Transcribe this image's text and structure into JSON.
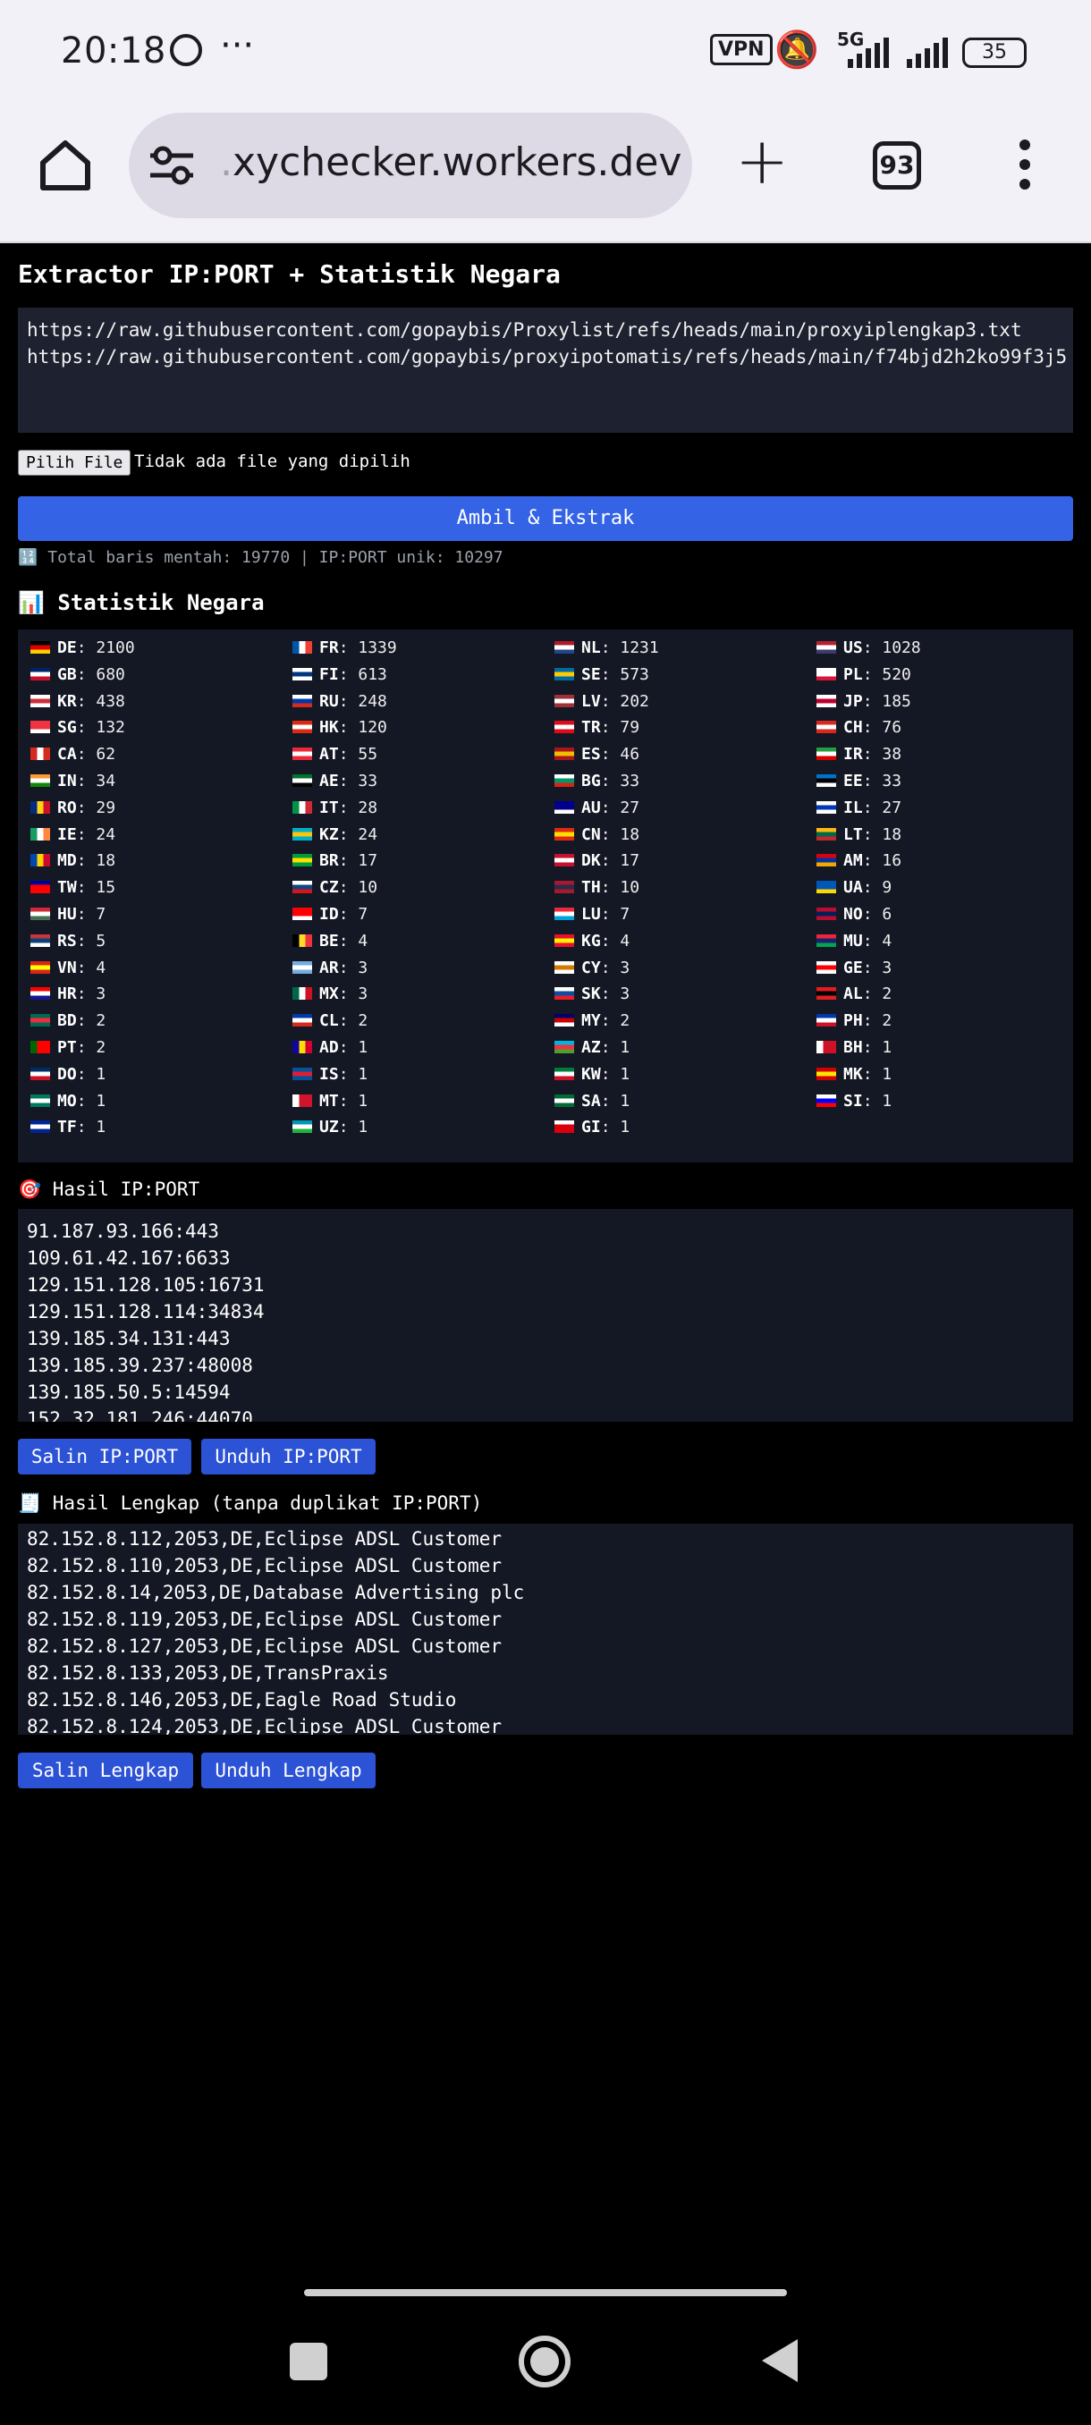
{
  "status": {
    "time": "20:18",
    "vpn": "VPN",
    "network": "5G",
    "battery": "35"
  },
  "browser": {
    "url_prefix": ".",
    "url": "xychecker.workers.dev",
    "tab_count": "93"
  },
  "page": {
    "title": "Extractor IP:PORT + Statistik Negara",
    "urls_text": "https://raw.githubusercontent.com/gopaybis/Proxylist/refs/heads/main/proxyiplengkap3.txt\nhttps://raw.githubusercontent.com/gopaybis/proxyipotomatis/refs/heads/main/f74bjd2h2ko99f3j5",
    "file_button": "Pilih File",
    "file_status": "Tidak ada file yang dipilih",
    "fetch_button": "Ambil & Ekstrak",
    "totals": "🔢 Total baris mentah: 19770 | IP:PORT unik: 10297",
    "stats_heading": "📊 Statistik Negara",
    "result_heading": "🎯 Hasil IP:PORT",
    "result_text": "91.187.93.166:443\n109.61.42.167:6633\n129.151.128.105:16731\n129.151.128.114:34834\n139.185.34.131:443\n139.185.39.237:48008\n139.185.50.5:14594\n152.32.181.246:44070",
    "copy_ip_button": "Salin IP:PORT",
    "download_ip_button": "Unduh IP:PORT",
    "full_heading": "🧾 Hasil Lengkap (tanpa duplikat IP:PORT)",
    "full_text": "82.152.8.112,2053,DE,Eclipse ADSL Customer\n82.152.8.110,2053,DE,Eclipse ADSL Customer\n82.152.8.14,2053,DE,Database Advertising plc\n82.152.8.119,2053,DE,Eclipse ADSL Customer\n82.152.8.127,2053,DE,Eclipse ADSL Customer\n82.152.8.133,2053,DE,TransPraxis\n82.152.8.146,2053,DE,Eagle Road Studio\n82.152.8.124,2053,DE,Eclipse ADSL Customer",
    "copy_full_button": "Salin Lengkap",
    "download_full_button": "Unduh Lengkap"
  },
  "stats": [
    {
      "code": "DE",
      "count": "2100",
      "colors": [
        "#000000",
        "#dd0000",
        "#ffce00"
      ]
    },
    {
      "code": "FR",
      "count": "1339",
      "colors": [
        "#0055a4",
        "#ffffff",
        "#ef4135"
      ],
      "v": true
    },
    {
      "code": "NL",
      "count": "1231",
      "colors": [
        "#ae1c28",
        "#ffffff",
        "#21468b"
      ]
    },
    {
      "code": "US",
      "count": "1028",
      "colors": [
        "#b22234",
        "#ffffff",
        "#3c3b6e"
      ]
    },
    {
      "code": "GB",
      "count": "680",
      "colors": [
        "#012169",
        "#ffffff",
        "#c8102e"
      ]
    },
    {
      "code": "FI",
      "count": "613",
      "colors": [
        "#ffffff",
        "#003580",
        "#ffffff"
      ]
    },
    {
      "code": "SE",
      "count": "573",
      "colors": [
        "#006aa7",
        "#fecc00",
        "#006aa7"
      ]
    },
    {
      "code": "PL",
      "count": "520",
      "colors": [
        "#ffffff",
        "#ffffff",
        "#dc143c"
      ]
    },
    {
      "code": "KR",
      "count": "438",
      "colors": [
        "#ffffff",
        "#cd2e3a",
        "#ffffff"
      ]
    },
    {
      "code": "RU",
      "count": "248",
      "colors": [
        "#ffffff",
        "#0039a6",
        "#d52b1e"
      ]
    },
    {
      "code": "LV",
      "count": "202",
      "colors": [
        "#9e3039",
        "#ffffff",
        "#9e3039"
      ]
    },
    {
      "code": "JP",
      "count": "185",
      "colors": [
        "#ffffff",
        "#bc002d",
        "#ffffff"
      ]
    },
    {
      "code": "SG",
      "count": "132",
      "colors": [
        "#ef3340",
        "#ef3340",
        "#ffffff"
      ]
    },
    {
      "code": "HK",
      "count": "120",
      "colors": [
        "#de2910",
        "#ffffff",
        "#de2910"
      ]
    },
    {
      "code": "TR",
      "count": "79",
      "colors": [
        "#e30a17",
        "#ffffff",
        "#e30a17"
      ]
    },
    {
      "code": "CH",
      "count": "76",
      "colors": [
        "#da291c",
        "#ffffff",
        "#da291c"
      ]
    },
    {
      "code": "CA",
      "count": "62",
      "colors": [
        "#d52b1e",
        "#ffffff",
        "#d52b1e"
      ],
      "v": true
    },
    {
      "code": "AT",
      "count": "55",
      "colors": [
        "#ed2939",
        "#ffffff",
        "#ed2939"
      ]
    },
    {
      "code": "ES",
      "count": "46",
      "colors": [
        "#aa151b",
        "#f1bf00",
        "#aa151b"
      ]
    },
    {
      "code": "IR",
      "count": "38",
      "colors": [
        "#239f40",
        "#ffffff",
        "#da0000"
      ]
    },
    {
      "code": "IN",
      "count": "34",
      "colors": [
        "#ff9933",
        "#ffffff",
        "#138808"
      ]
    },
    {
      "code": "AE",
      "count": "33",
      "colors": [
        "#00732f",
        "#ffffff",
        "#000000"
      ]
    },
    {
      "code": "BG",
      "count": "33",
      "colors": [
        "#ffffff",
        "#00966e",
        "#d62612"
      ]
    },
    {
      "code": "EE",
      "count": "33",
      "colors": [
        "#0072ce",
        "#000000",
        "#ffffff"
      ]
    },
    {
      "code": "RO",
      "count": "29",
      "colors": [
        "#002b7f",
        "#fcd116",
        "#ce1126"
      ],
      "v": true
    },
    {
      "code": "IT",
      "count": "28",
      "colors": [
        "#009246",
        "#ffffff",
        "#ce2b37"
      ],
      "v": true
    },
    {
      "code": "AU",
      "count": "27",
      "colors": [
        "#00008b",
        "#00008b",
        "#ffffff"
      ]
    },
    {
      "code": "IL",
      "count": "27",
      "colors": [
        "#ffffff",
        "#0038b8",
        "#ffffff"
      ]
    },
    {
      "code": "IE",
      "count": "24",
      "colors": [
        "#169b62",
        "#ffffff",
        "#ff883e"
      ],
      "v": true
    },
    {
      "code": "KZ",
      "count": "24",
      "colors": [
        "#00afca",
        "#fec50c",
        "#00afca"
      ]
    },
    {
      "code": "CN",
      "count": "18",
      "colors": [
        "#de2910",
        "#ffde00",
        "#de2910"
      ]
    },
    {
      "code": "LT",
      "count": "18",
      "colors": [
        "#fdb913",
        "#006a44",
        "#c1272d"
      ]
    },
    {
      "code": "MD",
      "count": "18",
      "colors": [
        "#0046ae",
        "#ffd200",
        "#cc092f"
      ],
      "v": true
    },
    {
      "code": "BR",
      "count": "17",
      "colors": [
        "#009c3b",
        "#ffdf00",
        "#009c3b"
      ]
    },
    {
      "code": "DK",
      "count": "17",
      "colors": [
        "#c8102e",
        "#ffffff",
        "#c8102e"
      ]
    },
    {
      "code": "AM",
      "count": "16",
      "colors": [
        "#d90012",
        "#0033a0",
        "#f2a800"
      ]
    },
    {
      "code": "TW",
      "count": "15",
      "colors": [
        "#000095",
        "#fe0000",
        "#fe0000"
      ]
    },
    {
      "code": "CZ",
      "count": "10",
      "colors": [
        "#ffffff",
        "#11457e",
        "#d7141a"
      ]
    },
    {
      "code": "TH",
      "count": "10",
      "colors": [
        "#a51931",
        "#2d2a4a",
        "#a51931"
      ]
    },
    {
      "code": "UA",
      "count": "9",
      "colors": [
        "#0057b7",
        "#0057b7",
        "#ffd700"
      ]
    },
    {
      "code": "HU",
      "count": "7",
      "colors": [
        "#ce2939",
        "#ffffff",
        "#477050"
      ]
    },
    {
      "code": "ID",
      "count": "7",
      "colors": [
        "#ff0000",
        "#ff0000",
        "#ffffff"
      ]
    },
    {
      "code": "LU",
      "count": "7",
      "colors": [
        "#ed2939",
        "#ffffff",
        "#00a1de"
      ]
    },
    {
      "code": "NO",
      "count": "6",
      "colors": [
        "#ba0c2f",
        "#00205b",
        "#ba0c2f"
      ]
    },
    {
      "code": "RS",
      "count": "5",
      "colors": [
        "#c6363c",
        "#0c4076",
        "#ffffff"
      ]
    },
    {
      "code": "BE",
      "count": "4",
      "colors": [
        "#000000",
        "#fdda24",
        "#ef3340"
      ],
      "v": true
    },
    {
      "code": "KG",
      "count": "4",
      "colors": [
        "#e8112d",
        "#ffef00",
        "#e8112d"
      ]
    },
    {
      "code": "MU",
      "count": "4",
      "colors": [
        "#ea2839",
        "#1a206d",
        "#00a551"
      ]
    },
    {
      "code": "VN",
      "count": "4",
      "colors": [
        "#da251d",
        "#ffff00",
        "#da251d"
      ]
    },
    {
      "code": "AR",
      "count": "3",
      "colors": [
        "#74acdf",
        "#ffffff",
        "#74acdf"
      ]
    },
    {
      "code": "CY",
      "count": "3",
      "colors": [
        "#ffffff",
        "#d57800",
        "#ffffff"
      ]
    },
    {
      "code": "GE",
      "count": "3",
      "colors": [
        "#ffffff",
        "#ff0000",
        "#ffffff"
      ]
    },
    {
      "code": "HR",
      "count": "3",
      "colors": [
        "#ff0000",
        "#ffffff",
        "#171796"
      ]
    },
    {
      "code": "MX",
      "count": "3",
      "colors": [
        "#006847",
        "#ffffff",
        "#ce1126"
      ],
      "v": true
    },
    {
      "code": "SK",
      "count": "3",
      "colors": [
        "#ffffff",
        "#0b4ea2",
        "#ee1c25"
      ]
    },
    {
      "code": "AL",
      "count": "2",
      "colors": [
        "#e41e20",
        "#000000",
        "#e41e20"
      ]
    },
    {
      "code": "BD",
      "count": "2",
      "colors": [
        "#006a4e",
        "#f42a41",
        "#006a4e"
      ]
    },
    {
      "code": "CL",
      "count": "2",
      "colors": [
        "#0039a6",
        "#ffffff",
        "#d52b1e"
      ]
    },
    {
      "code": "MY",
      "count": "2",
      "colors": [
        "#010066",
        "#cc0001",
        "#ffffff"
      ]
    },
    {
      "code": "PH",
      "count": "2",
      "colors": [
        "#0038a8",
        "#ffffff",
        "#ce1126"
      ]
    },
    {
      "code": "PT",
      "count": "2",
      "colors": [
        "#006600",
        "#ff0000",
        "#ff0000"
      ],
      "v": true
    },
    {
      "code": "AD",
      "count": "1",
      "colors": [
        "#10069f",
        "#fedd00",
        "#d50032"
      ],
      "v": true
    },
    {
      "code": "AZ",
      "count": "1",
      "colors": [
        "#00b5e2",
        "#ef3340",
        "#509e2f"
      ]
    },
    {
      "code": "BH",
      "count": "1",
      "colors": [
        "#ffffff",
        "#ce1126",
        "#ce1126"
      ],
      "v": true
    },
    {
      "code": "DO",
      "count": "1",
      "colors": [
        "#002d62",
        "#ffffff",
        "#ce1126"
      ]
    },
    {
      "code": "IS",
      "count": "1",
      "colors": [
        "#02529c",
        "#dc1e35",
        "#02529c"
      ]
    },
    {
      "code": "KW",
      "count": "1",
      "colors": [
        "#007a3d",
        "#ffffff",
        "#ce1126"
      ]
    },
    {
      "code": "MK",
      "count": "1",
      "colors": [
        "#d20000",
        "#ffe600",
        "#d20000"
      ]
    },
    {
      "code": "MO",
      "count": "1",
      "colors": [
        "#00785e",
        "#ffffff",
        "#00785e"
      ]
    },
    {
      "code": "MT",
      "count": "1",
      "colors": [
        "#ffffff",
        "#cf142b",
        "#cf142b"
      ],
      "v": true
    },
    {
      "code": "SA",
      "count": "1",
      "colors": [
        "#006c35",
        "#ffffff",
        "#006c35"
      ]
    },
    {
      "code": "SI",
      "count": "1",
      "colors": [
        "#ffffff",
        "#0000ff",
        "#ff0000"
      ]
    },
    {
      "code": "TF",
      "count": "1",
      "colors": [
        "#002395",
        "#ffffff",
        "#002395"
      ]
    },
    {
      "code": "UZ",
      "count": "1",
      "colors": [
        "#0099b5",
        "#ffffff",
        "#1eb53a"
      ]
    },
    {
      "code": "GI",
      "count": "1",
      "colors": [
        "#ffffff",
        "#da000c",
        "#da000c"
      ]
    }
  ]
}
